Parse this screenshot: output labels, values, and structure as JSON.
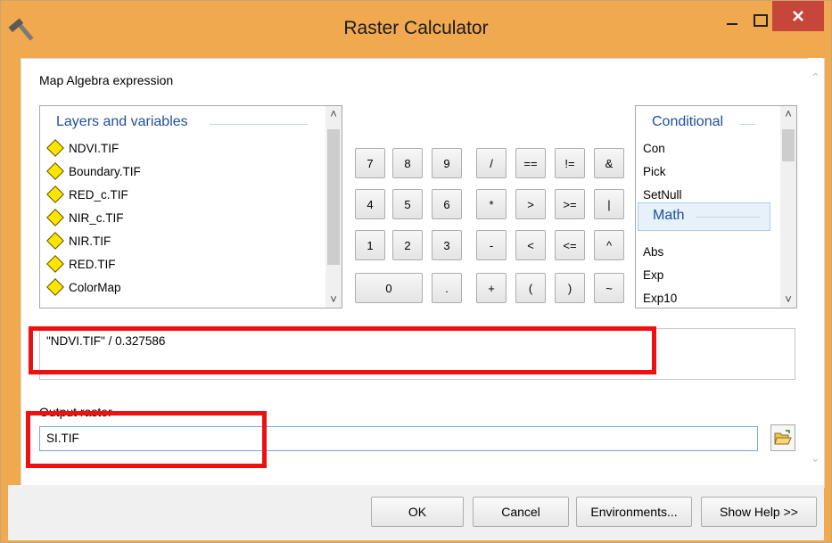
{
  "window": {
    "title": "Raster Calculator",
    "controls": {
      "minimize": "_",
      "maximize": "☐",
      "close": "✕"
    }
  },
  "expression_label": "Map Algebra expression",
  "layers": {
    "header": "Layers and variables",
    "items": [
      "NDVI.TIF",
      "Boundary.TIF",
      "RED_c.TIF",
      "NIR_c.TIF",
      "NIR.TIF",
      "RED.TIF",
      "ColorMap"
    ],
    "item_icon": "yellow-diamond-icon"
  },
  "calculator": {
    "rows": [
      [
        "7",
        "8",
        "9",
        "/",
        "==",
        "!=",
        "&"
      ],
      [
        "4",
        "5",
        "6",
        "*",
        ">",
        ">=",
        "|"
      ],
      [
        "1",
        "2",
        "3",
        "-",
        "<",
        "<=",
        "^"
      ],
      [
        "0",
        ".",
        "+",
        "(",
        ")",
        "~"
      ]
    ]
  },
  "functions": {
    "conditional_header": "Conditional",
    "conditional_items": [
      "Con",
      "Pick",
      "SetNull"
    ],
    "math_header": "Math",
    "math_items": [
      "Abs",
      "Exp",
      "Exp10"
    ]
  },
  "expression_value": "\"NDVI.TIF\" / 0.327586",
  "output": {
    "label": "Output raster",
    "value": "SI.TIF",
    "browse_icon": "open-folder-icon"
  },
  "buttons": {
    "ok": "OK",
    "cancel": "Cancel",
    "environments": "Environments...",
    "show_help": "Show Help >>"
  },
  "colors": {
    "title_bar": "#f0a94f",
    "close_button": "#c7463b",
    "highlight_box": "#ee1111",
    "group_header_text": "#1f4e9c",
    "diamond_fill": "#ffe500"
  }
}
